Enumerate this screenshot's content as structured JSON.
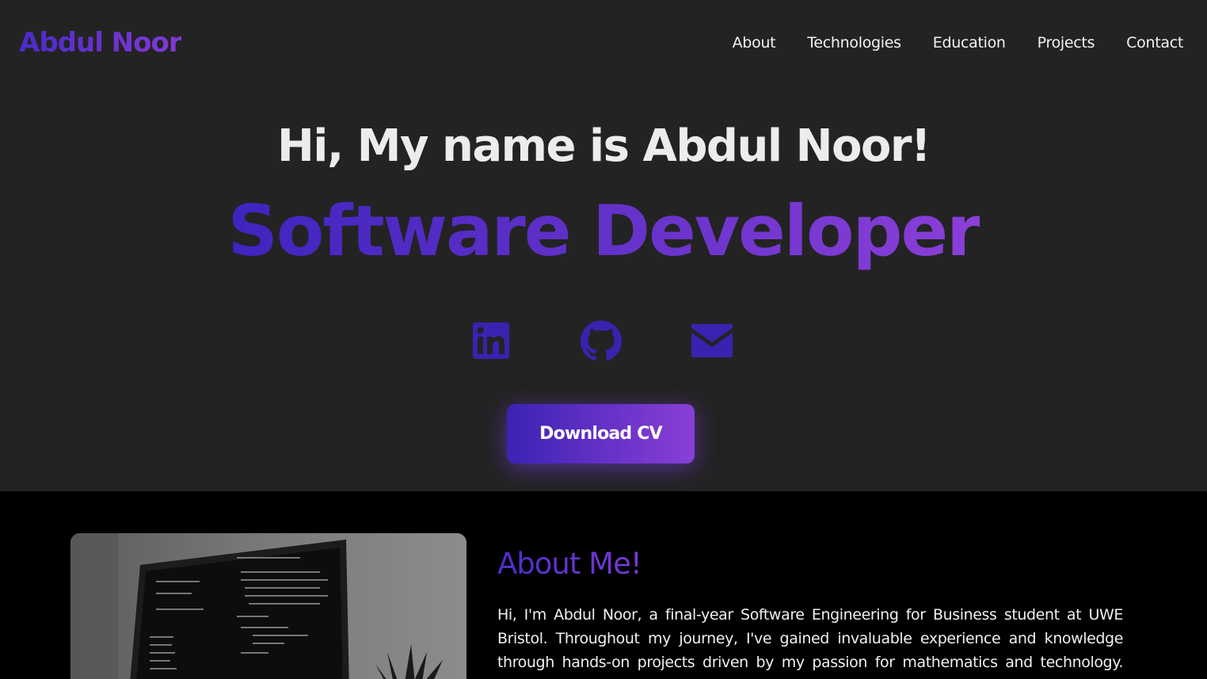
{
  "header": {
    "logo": "Abdul Noor",
    "nav": [
      "About",
      "Technologies",
      "Education",
      "Projects",
      "Contact"
    ]
  },
  "hero": {
    "greeting": "Hi, My name is Abdul Noor!",
    "role": "Software Developer",
    "social": [
      {
        "name": "linkedin-icon"
      },
      {
        "name": "github-icon"
      },
      {
        "name": "email-icon"
      }
    ],
    "cv_button": "Download CV"
  },
  "about": {
    "title": "About Me!",
    "text": "Hi, I'm Abdul Noor, a final-year Software Engineering for Business student at UWE Bristol. Throughout my journey, I've gained invaluable experience and knowledge through hands-on projects driven by my passion for mathematics and technology. From developing"
  },
  "colors": {
    "accent_start": "#3c22b4",
    "accent_end": "#8a3fd6",
    "hero_bg": "#232323",
    "page_bg": "#000000"
  }
}
